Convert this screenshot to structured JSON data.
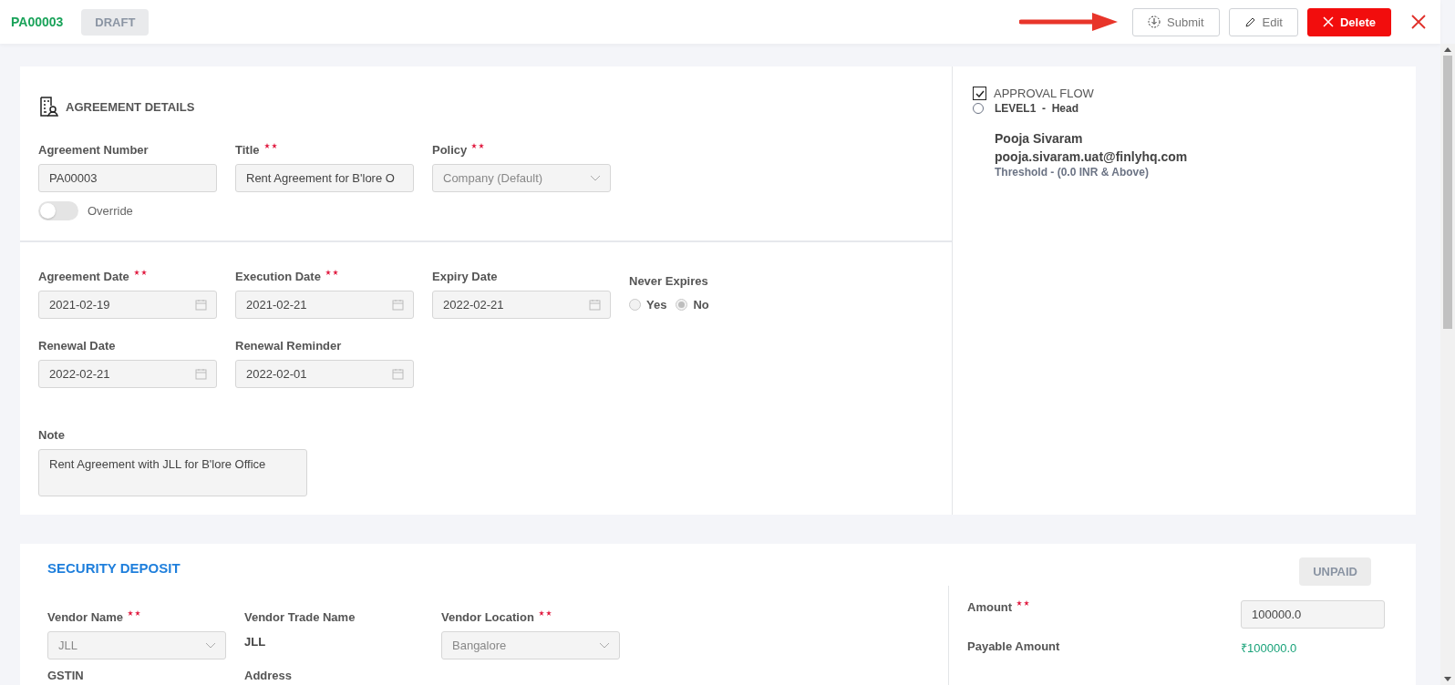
{
  "header": {
    "record_id": "PA00003",
    "status": "DRAFT",
    "buttons": [
      {
        "kind": "submit",
        "label": "Submit"
      },
      {
        "kind": "edit",
        "label": "Edit"
      },
      {
        "kind": "delete",
        "label": "Delete"
      }
    ]
  },
  "agreement_details": {
    "title": "AGREEMENT DETAILS",
    "rows": [
      [
        {
          "kind": "text",
          "label": "Agreement Number",
          "required": false,
          "value": "PA00003"
        },
        {
          "kind": "text",
          "label": "Title",
          "required": true,
          "value": "Rent Agreement for B'lore O"
        },
        {
          "kind": "select",
          "label": "Policy",
          "required": true,
          "value": "Company (Default)"
        }
      ]
    ],
    "override": {
      "label": "Override",
      "on": false
    },
    "date_rows": [
      [
        {
          "kind": "date",
          "label": "Agreement Date",
          "required": true,
          "value": "2021-02-19"
        },
        {
          "kind": "date",
          "label": "Execution Date",
          "required": true,
          "value": "2021-02-21"
        },
        {
          "kind": "date",
          "label": "Expiry Date",
          "required": false,
          "value": "2022-02-21"
        },
        {
          "kind": "radio",
          "label": "Never Expires",
          "required": false,
          "options": [
            {
              "label": "Yes",
              "selected": false
            },
            {
              "label": "No",
              "selected": true
            }
          ]
        }
      ],
      [
        {
          "kind": "date",
          "label": "Renewal Date",
          "required": false,
          "value": "2022-02-21"
        },
        {
          "kind": "date",
          "label": "Renewal Reminder",
          "required": false,
          "value": "2022-02-01"
        }
      ]
    ],
    "note": {
      "label": "Note",
      "value": "Rent Agreement with JLL for B'lore Office"
    }
  },
  "approval_flow": {
    "title": "APPROVAL FLOW",
    "checked": true,
    "levels": [
      {
        "selected": false,
        "level": "LEVEL1",
        "separator": "-",
        "role": "Head",
        "name": "Pooja Sivaram",
        "email": "pooja.sivaram.uat@finlyhq.com",
        "threshold": "Threshold -  (0.0 INR & Above)"
      }
    ]
  },
  "security_deposit": {
    "title": "SECURITY DEPOSIT",
    "status": "UNPAID",
    "fields": [
      {
        "kind": "select",
        "label": "Vendor Name",
        "required": true,
        "value": "JLL"
      },
      {
        "kind": "static",
        "label": "Vendor Trade Name",
        "required": false,
        "value": "JLL"
      },
      {
        "kind": "select",
        "label": "Vendor Location",
        "required": true,
        "value": "Bangalore"
      },
      {
        "kind": "static",
        "label": "GSTIN",
        "required": false
      },
      {
        "kind": "static",
        "label": "Address",
        "required": false
      }
    ],
    "amounts": [
      {
        "kind": "input",
        "label": "Amount",
        "required": true,
        "value": "100000.0"
      },
      {
        "kind": "value",
        "label": "Payable Amount",
        "required": false,
        "value": "₹100000.0"
      }
    ]
  }
}
